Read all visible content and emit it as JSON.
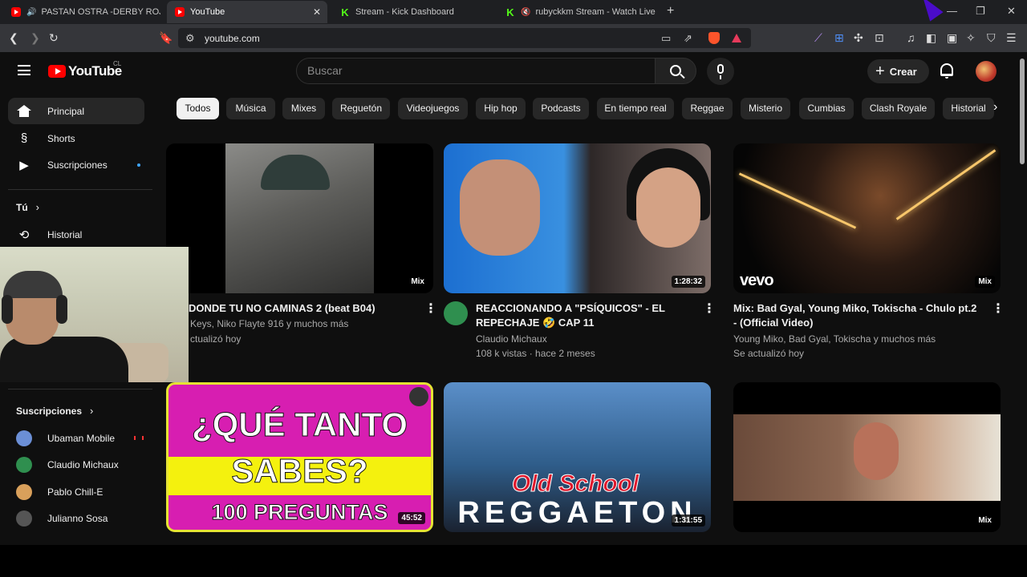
{
  "browser": {
    "tabs": [
      {
        "title": "PASTAN OSTRA -DERBY ROJO (D",
        "favicon": "youtube"
      },
      {
        "title": "YouTube",
        "favicon": "youtube"
      },
      {
        "title": "Stream - Kick Dashboard",
        "favicon": "kick"
      },
      {
        "title": "rubyckkm Stream - Watch Live o",
        "favicon": "kick"
      }
    ],
    "url": "youtube.com"
  },
  "header": {
    "logo_text": "YouTube",
    "country_code": "CL",
    "search_placeholder": "Buscar",
    "create_label": "Crear"
  },
  "sidebar": {
    "items": [
      {
        "label": "Principal",
        "icon": "home-icon"
      },
      {
        "label": "Shorts",
        "icon": "shorts-icon"
      },
      {
        "label": "Suscripciones",
        "icon": "subscriptions-icon"
      }
    ],
    "you_label": "Tú",
    "history_label": "Historial",
    "subscriptions_header": "Suscripciones",
    "channels": [
      {
        "name": "Ubaman Mobile",
        "color": "#6b8fd6"
      },
      {
        "name": "Claudio Michaux",
        "color": "#2f8f4f"
      },
      {
        "name": "Pablo Chill-E",
        "color": "#d9a05b"
      },
      {
        "name": "Julianno Sosa",
        "color": "#555555"
      }
    ]
  },
  "chips": [
    "Todos",
    "Música",
    "Mixes",
    "Reguetón",
    "Videojuegos",
    "Hip hop",
    "Podcasts",
    "En tiempo real",
    "Reggae",
    "Misterio",
    "Cumbias",
    "Clash Royale",
    "Historial"
  ],
  "videos": [
    {
      "title": "DONDE TU NO CAMINAS 2 (beat B04)",
      "meta1": "Keys, Niko Flayte 916 y muchos más",
      "meta2": "ctualizó hoy",
      "badge": "Mix"
    },
    {
      "title": "REACCIONANDO A \"PSÍQUICOS\" - EL REPECHAJE 🤣 CAP 11",
      "meta1": "Claudio Michaux",
      "meta2": "108 k vistas · hace 2 meses",
      "badge": "1:28:32"
    },
    {
      "title": "Mix: Bad Gyal, Young Miko, Tokischa - Chulo pt.2 - (Official Video)",
      "meta1": "Young Miko, Bad Gyal, Tokischa y muchos más",
      "meta2": "Se actualizó hoy",
      "badge": "Mix",
      "brand": "vevo"
    },
    {
      "badge": "45:52",
      "thumb_lines": [
        "¿QUÉ TANTO",
        "SABES?",
        "100 PREGUNTAS"
      ]
    },
    {
      "badge": "1:31:55",
      "thumb_lines": [
        "Old School",
        "REGGAETON"
      ]
    },
    {
      "badge": "Mix"
    }
  ],
  "colors": {
    "background": "#0f0f0f",
    "chip_active": "#f1f1f1",
    "brand_red": "#ff0000"
  }
}
